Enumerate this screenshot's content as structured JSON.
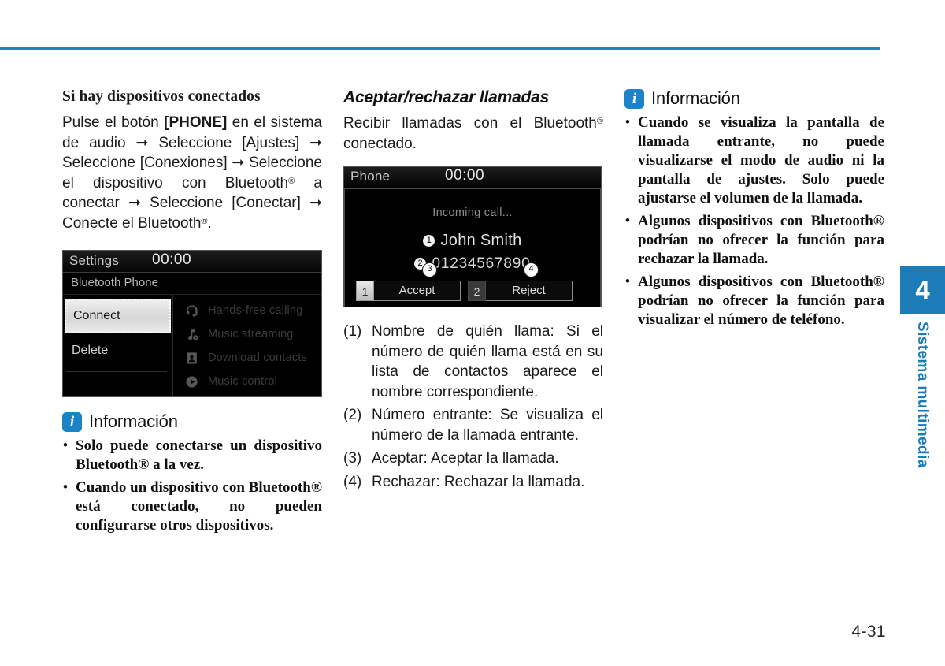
{
  "page": {
    "number": "4-31",
    "chapter_number": "4",
    "chapter_label": "Sistema multimedia",
    "rule_color": "#1e83c4",
    "accent_color": "#1b7cb8"
  },
  "column1": {
    "heading": "Si hay dispositivos conectados",
    "paragraph_parts": {
      "p1": "Pulse el botón ",
      "p2": "[PHONE]",
      "p3": " en el sistema de audio ➞ Seleccione [Ajustes] ➞ Seleccione [Conexiones] ➞ Seleccione el dispositivo con Bluetooth",
      "p4": " a conectar ➞ Seleccione [Conectar] ➞ Conecte el Bluetooth",
      "p5": "."
    },
    "settings_screen": {
      "title": "Settings",
      "clock": "00:00",
      "subtitle": "Bluetooth Phone",
      "connect_label": "Connect",
      "delete_label": "Delete",
      "features": [
        {
          "icon": "headset-icon",
          "label": "Hands-free calling"
        },
        {
          "icon": "music-streaming-icon",
          "label": "Music streaming"
        },
        {
          "icon": "download-contacts-icon",
          "label": "Download contacts"
        },
        {
          "icon": "music-control-icon",
          "label": "Music control"
        }
      ]
    },
    "info": {
      "title": "Información",
      "icon": "info-icon",
      "items": [
        "Solo puede conectarse un dispositivo Bluetooth® a la vez.",
        "Cuando un dispositivo con Bluetooth® está conectado, no pueden configurarse otros dispositivos."
      ]
    }
  },
  "column2": {
    "heading": "Aceptar/rechazar llamadas",
    "intro_p1": "Recibir llamadas con el Bluetooth",
    "intro_p2": " conectado.",
    "phone_screen": {
      "title": "Phone",
      "clock": "00:00",
      "status": "Incoming call...",
      "caller_marker": "1",
      "caller_name": "John Smith",
      "number_marker": "2",
      "caller_number": "01234567890",
      "accept_key": "1",
      "accept_label": "Accept",
      "accept_callout": "3",
      "reject_key": "2",
      "reject_label": "Reject",
      "reject_callout": "4"
    },
    "numbered_items": [
      {
        "label": "(1)",
        "text": "Nombre de quién llama: Si el número de quién llama está en su lista de contactos aparece el nombre correspondiente."
      },
      {
        "label": "(2)",
        "text": "Número entrante: Se visualiza el número de la llamada entrante."
      },
      {
        "label": "(3)",
        "text": "Aceptar: Aceptar la llamada."
      },
      {
        "label": "(4)",
        "text": "Rechazar: Rechazar la llamada."
      }
    ]
  },
  "column3": {
    "info": {
      "title": "Información",
      "icon": "info-icon",
      "items": [
        "Cuando se visualiza la pantalla de llamada entrante, no puede visualizarse el modo de audio ni la pantalla de ajustes. Solo puede ajustarse el volumen de la llamada.",
        "Algunos dispositivos con Bluetooth® podrían no ofrecer la función para rechazar la llamada.",
        "Algunos dispositivos con Bluetooth® podrían no ofrecer la función para visualizar el número de teléfono."
      ]
    }
  }
}
